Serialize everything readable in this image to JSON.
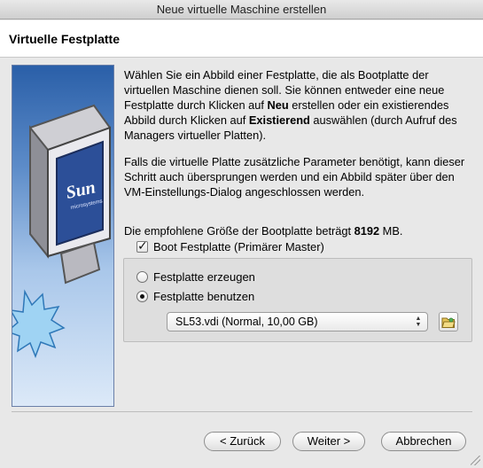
{
  "window": {
    "title": "Neue virtuelle Maschine erstellen"
  },
  "header": {
    "title": "Virtuelle Festplatte"
  },
  "description": {
    "p1_a": "Wählen Sie ein Abbild einer Festplatte, die als Bootplatte der virtuellen Maschine dienen soll. Sie können entweder eine neue Festplatte durch Klicken auf ",
    "p1_new": "Neu",
    "p1_b": " erstellen oder ein existierendes Abbild durch Klicken auf ",
    "p1_existing": "Existierend",
    "p1_c": " auswählen (durch Aufruf des Managers virtueller Platten).",
    "p2": "Falls die virtuelle Platte zusätzliche Parameter benötigt, kann dieser Schritt auch übersprungen werden und ein Abbild später über den VM-Einstellungs-Dialog angeschlossen werden.",
    "p3_a": "Die empfohlene Größe der Bootplatte beträgt ",
    "p3_size": "8192",
    "p3_b": " MB."
  },
  "boot_checkbox": {
    "label": "Boot Festplatte (Primärer Master)",
    "checked": true
  },
  "options": {
    "create": {
      "label": "Festplatte erzeugen",
      "selected": false
    },
    "use": {
      "label": "Festplatte benutzen",
      "selected": true
    }
  },
  "disk_select": {
    "value": "SL53.vdi (Normal, 10,00 GB)"
  },
  "buttons": {
    "back": "< Zurück",
    "next": "Weiter >",
    "cancel": "Abbrechen"
  },
  "side_image": {
    "logo_text": "Sun",
    "logo_subtext": "microsystems"
  },
  "icons": {
    "folder": "folder-open-icon",
    "select_arrows": "up-down-arrows-icon"
  }
}
